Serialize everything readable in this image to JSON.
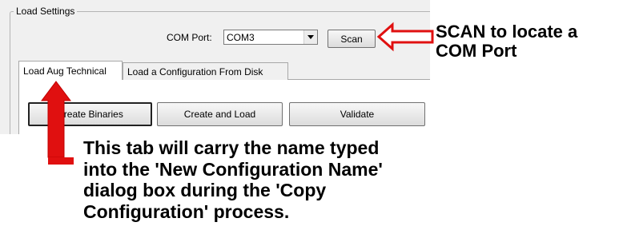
{
  "load_settings": {
    "group_title": "Load Settings",
    "com_port_label": "COM Port:",
    "com_port_value": "COM3",
    "scan_label": "Scan"
  },
  "tabs": [
    {
      "label": "Load Aug Technical",
      "active": true
    },
    {
      "label": "Load a Configuration From Disk",
      "active": false
    }
  ],
  "actions": {
    "create_binaries": "Create Binaries",
    "create_and_load": "Create and Load",
    "validate": "Validate"
  },
  "annotations": {
    "scan_note_line1": "SCAN to locate a",
    "scan_note_line2": "COM Port",
    "tab_note_lines": [
      "This tab will carry the name typed",
      "into the 'New Configuration Name'",
      "dialog box during the 'Copy",
      "Configuration' process."
    ]
  },
  "colors": {
    "arrow": "#e01010",
    "panel_bg": "#f0f0f0"
  },
  "icons": [
    "dropdown-arrow-icon",
    "red-left-arrow-icon",
    "red-up-arrow-icon"
  ]
}
